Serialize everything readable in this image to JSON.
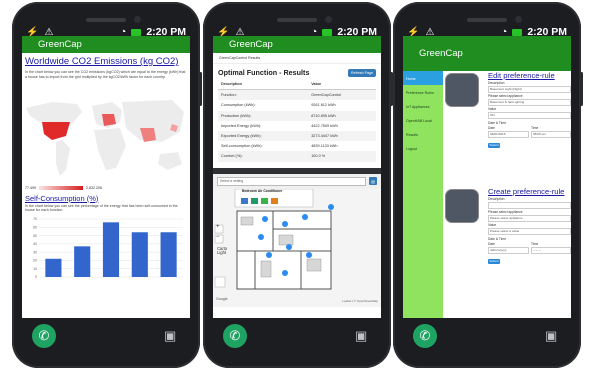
{
  "status": {
    "time": "2:20 PM"
  },
  "app": {
    "name": "GreenCap"
  },
  "screen1": {
    "title": "Worldwide CO2 Emissions (kg CO2)",
    "description": "In the chart below you can see the CO2 emissions (kgCO2) which are equal to the energy (kWh) that a house has to import from the grid multiplied by the kgCO2/kWh factor for each country.",
    "legend_min": "77.499",
    "legend_max": "2,832.206",
    "section_title": "Self-Consumption (%)",
    "section_desc": "In the chart below you can see the percentage of the energy that has been self-consumed in the house for each function.",
    "chart_data": {
      "type": "bar",
      "categories": [
        "",
        "",
        "",
        "",
        ""
      ],
      "values": [
        22,
        37,
        66,
        54,
        54
      ],
      "ylim": [
        0,
        70
      ],
      "yticks": [
        "70",
        "60",
        "50",
        "40",
        "30",
        "20",
        "10",
        "0"
      ],
      "color": "#3366cc"
    }
  },
  "screen2": {
    "breadcrumb": "GreenCapControl Results",
    "title": "Optimal Function - Results",
    "refresh_label": "Refresh Page",
    "table": {
      "headers": [
        "Description",
        "Value"
      ],
      "rows": [
        [
          "Function:",
          "GreenCapControl"
        ],
        [
          "Consumption (kWh):",
          "9261.612 kWh"
        ],
        [
          "Production (kWh):",
          "8710.695 kWh"
        ],
        [
          "Imported Energy (kWh):",
          "4422.7509 kWh"
        ],
        [
          "Exported Energy (kWh):",
          "3273.4447 kWh"
        ],
        [
          "Self-consumption (kWh):",
          "4839.1133 kWh"
        ],
        [
          "Comfort (%):",
          "100.0 %"
        ]
      ]
    },
    "select_placeholder": "Select a setting",
    "floor_popup_title": "Bedroom Air Conditioner",
    "map_layer_label": "Carto Light",
    "zoom_in": "+",
    "zoom_out": "−",
    "google_label": "Google",
    "attribution": "Leaflet | © OpenStreetMap"
  },
  "screen3": {
    "menu": [
      "Home",
      "Preference Rules",
      "IoT Appliances",
      "OpenHAB Local",
      "Results",
      "Logout"
    ],
    "edit_title": "Edit preference-rule",
    "create_title": "Create preference-rule",
    "edit": {
      "description_label": "Description",
      "description_value": "Basement Light (Night)",
      "appliance_label": "Please select appliance",
      "appliance_value": "Basement & hall Lighting",
      "value_label": "Value",
      "value_value": "ON",
      "datetime_label": "Date & Time",
      "date_label": "Date",
      "date_value": "06/01/2016",
      "time_label": "Time",
      "time_value": "08:00 pm",
      "submit_label": "Submit"
    },
    "create": {
      "description_label": "Description",
      "appliance_label": "Please select appliance",
      "appliance_value": "Please select appliance",
      "value_label": "Value",
      "value_value": "Please select a value",
      "datetime_label": "Date & Time",
      "date_label": "Date",
      "date_value": "dd/mm/yyyy",
      "time_label": "Time",
      "time_value": "--:-- --",
      "submit_label": "Submit"
    }
  },
  "colors": {
    "appbar": "#1f8d1f",
    "sidebar": "#8fe35f",
    "link": "#1a1aa4"
  }
}
